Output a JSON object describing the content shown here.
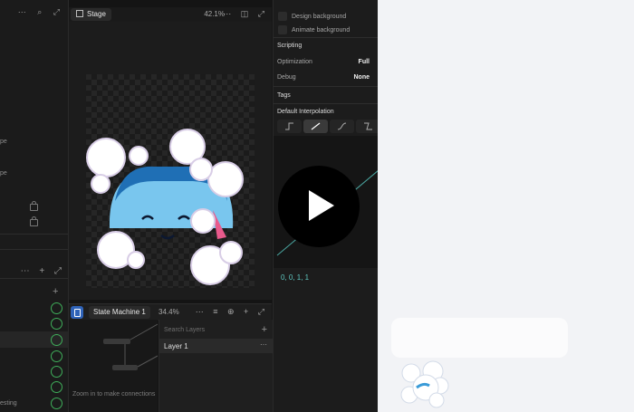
{
  "left_panel": {
    "row_texts": [
      "pe",
      "pe"
    ],
    "bottom_text": "esting"
  },
  "stage": {
    "tab_label": "Stage",
    "zoom": "42.1%"
  },
  "state_machine": {
    "tab_label": "State Machine 1",
    "zoom": "34.4%",
    "hint": "Zoom in to make connections",
    "layers_search_placeholder": "Search Layers",
    "layers": [
      "Layer 1"
    ]
  },
  "inspector": {
    "design_background": "Design background",
    "animate_background": "Animate background",
    "scripting_heading": "Scripting",
    "optimization_label": "Optimization",
    "optimization_value": "Full",
    "debug_label": "Debug",
    "debug_value": "None",
    "tags_heading": "Tags",
    "interp_heading": "Default Interpolation",
    "curve_values": "0, 0, 1, 1"
  },
  "colors": {
    "accent_blue": "#2f63b8",
    "status_green": "#3fae5a",
    "curve_teal": "#5fc7c0"
  },
  "icons": [
    "grid-icon",
    "play-icon",
    "plus-icon",
    "lock-icon"
  ]
}
